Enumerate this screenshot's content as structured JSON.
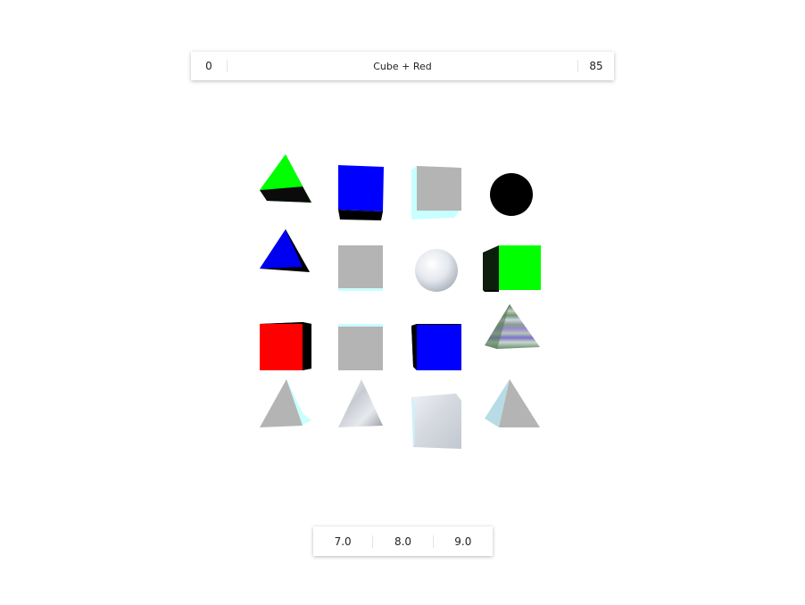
{
  "top_bar": {
    "left_value": "0",
    "prompt": "Cube + Red",
    "right_value": "85"
  },
  "grid": [
    {
      "shape": "pyramid",
      "color": "green"
    },
    {
      "shape": "cube",
      "color": "blue"
    },
    {
      "shape": "cube",
      "color": "gray"
    },
    {
      "shape": "sphere",
      "color": "black"
    },
    {
      "shape": "pyramid",
      "color": "blue"
    },
    {
      "shape": "cube",
      "color": "gray"
    },
    {
      "shape": "sphere",
      "color": "cloud-texture"
    },
    {
      "shape": "cube",
      "color": "green"
    },
    {
      "shape": "cube",
      "color": "red"
    },
    {
      "shape": "cube",
      "color": "gray"
    },
    {
      "shape": "cube",
      "color": "blue"
    },
    {
      "shape": "pyramid",
      "color": "striped-texture"
    },
    {
      "shape": "pyramid",
      "color": "gray"
    },
    {
      "shape": "pyramid",
      "color": "cloud-texture"
    },
    {
      "shape": "cube",
      "color": "cloud-texture"
    },
    {
      "shape": "pyramid",
      "color": "gray"
    }
  ],
  "bottom_bar": {
    "options": [
      "7.0",
      "8.0",
      "9.0"
    ]
  }
}
